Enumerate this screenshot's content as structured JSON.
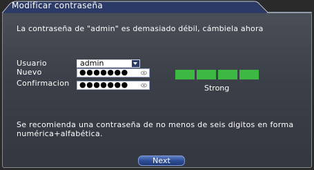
{
  "dialog": {
    "title": "Modificar contraseña",
    "warning": "La contraseña de \"admin\" es demasiado débil, cámbiela ahora",
    "username_label": "Usuario",
    "username_value": "admin",
    "new_label": "Nuevo",
    "new_value": "●●●●●●●",
    "confirm_label": "Confirmacion",
    "confirm_value": "●●●●●●●",
    "strength_label": "Strong",
    "strength_level": 4,
    "strength_total": 4,
    "recommendation": "Se recomienda una contraseña de no menos de seis digitos en forma numérica+alfabética.",
    "next_label": "Next"
  },
  "colors": {
    "strength_bar": "#3db843",
    "title_bar": "#2b3a66",
    "accent": "#3b5aa8"
  },
  "icons": {
    "dropdown": "chevron-down-icon",
    "show_password": "eye-icon"
  }
}
